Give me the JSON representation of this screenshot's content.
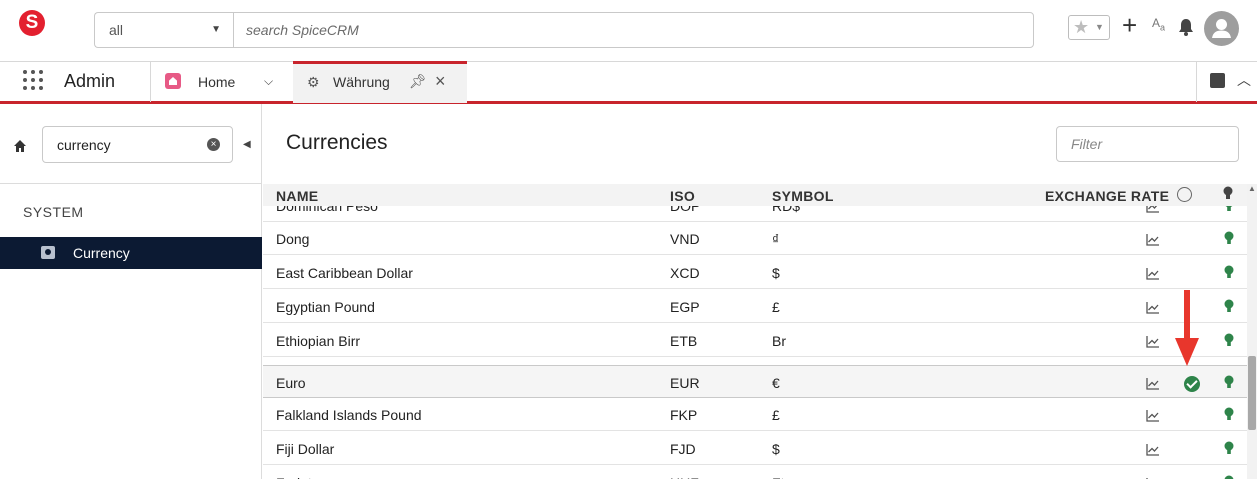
{
  "topbar": {
    "logo_letter": "S",
    "scope_value": "all",
    "search_placeholder": "search SpiceCRM",
    "font_size_label": "A",
    "font_size_sub": "a"
  },
  "nav": {
    "app_name": "Admin",
    "home_label": "Home",
    "active_tab_label": "Währung"
  },
  "sidebar": {
    "search_value": "currency",
    "section_label": "SYSTEM",
    "items": [
      {
        "label": "Currency"
      }
    ]
  },
  "main": {
    "title": "Currencies",
    "filter_placeholder": "Filter",
    "columns": {
      "name": "NAME",
      "iso": "ISO",
      "symbol": "SYMBOL",
      "rate": "EXCHANGE RATE"
    },
    "rows": [
      {
        "name": "Dominican Peso",
        "iso": "DOP",
        "symbol": "RD$",
        "system_default": false
      },
      {
        "name": "Dong",
        "iso": "VND",
        "symbol": "₫",
        "system_default": false
      },
      {
        "name": "East Caribbean Dollar",
        "iso": "XCD",
        "symbol": "$",
        "system_default": false
      },
      {
        "name": "Egyptian Pound",
        "iso": "EGP",
        "symbol": "£",
        "system_default": false
      },
      {
        "name": "Ethiopian Birr",
        "iso": "ETB",
        "symbol": "Br",
        "system_default": false
      },
      {
        "name": "Euro",
        "iso": "EUR",
        "symbol": "€",
        "system_default": true
      },
      {
        "name": "Falkland Islands Pound",
        "iso": "FKP",
        "symbol": "£",
        "system_default": false
      },
      {
        "name": "Fiji Dollar",
        "iso": "FJD",
        "symbol": "$",
        "system_default": false
      },
      {
        "name": "Forint",
        "iso": "HUF",
        "symbol": "Ft",
        "system_default": false
      }
    ]
  },
  "colors": {
    "brand_red": "#c8242c",
    "sidebar_selected": "#0c1a33",
    "bulb_green": "#2e844a",
    "arrow_red": "#e8362c"
  }
}
